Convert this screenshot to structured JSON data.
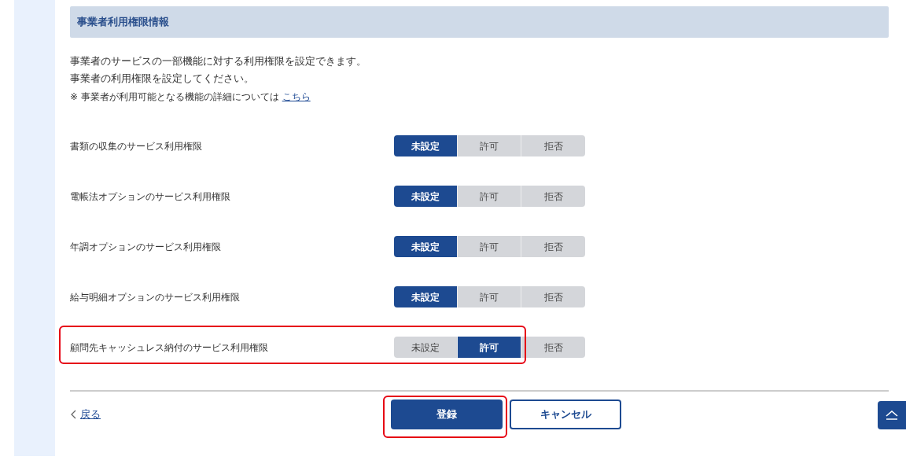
{
  "section": {
    "title": "事業者利用権限情報"
  },
  "description": [
    "事業者のサービスの一部機能に対する利用権限を設定できます。",
    "事業者の利用権限を設定してください。"
  ],
  "note": {
    "text": "※ 事業者が利用可能となる機能の詳細については",
    "link": "こちら"
  },
  "permissions": [
    {
      "label": "書類の収集のサービス利用権限",
      "highlighted": false,
      "options": [
        {
          "label": "未設定",
          "selected": true
        },
        {
          "label": "許可",
          "selected": false
        },
        {
          "label": "拒否",
          "selected": false
        }
      ]
    },
    {
      "label": "電帳法オプションのサービス利用権限",
      "highlighted": false,
      "options": [
        {
          "label": "未設定",
          "selected": true
        },
        {
          "label": "許可",
          "selected": false
        },
        {
          "label": "拒否",
          "selected": false
        }
      ]
    },
    {
      "label": "年調オプションのサービス利用権限",
      "highlighted": false,
      "options": [
        {
          "label": "未設定",
          "selected": true
        },
        {
          "label": "許可",
          "selected": false
        },
        {
          "label": "拒否",
          "selected": false
        }
      ]
    },
    {
      "label": "給与明細オプションのサービス利用権限",
      "highlighted": false,
      "options": [
        {
          "label": "未設定",
          "selected": true
        },
        {
          "label": "許可",
          "selected": false
        },
        {
          "label": "拒否",
          "selected": false
        }
      ]
    },
    {
      "label": "顧問先キャッシュレス納付のサービス利用権限",
      "highlighted": true,
      "options": [
        {
          "label": "未設定",
          "selected": false
        },
        {
          "label": "許可",
          "selected": true
        },
        {
          "label": "拒否",
          "selected": false
        }
      ]
    }
  ],
  "back_link": "戻る",
  "buttons": [
    {
      "label": "登録",
      "kind": "primary",
      "highlighted": true
    },
    {
      "label": "キャンセル",
      "kind": "outline",
      "highlighted": false
    }
  ]
}
